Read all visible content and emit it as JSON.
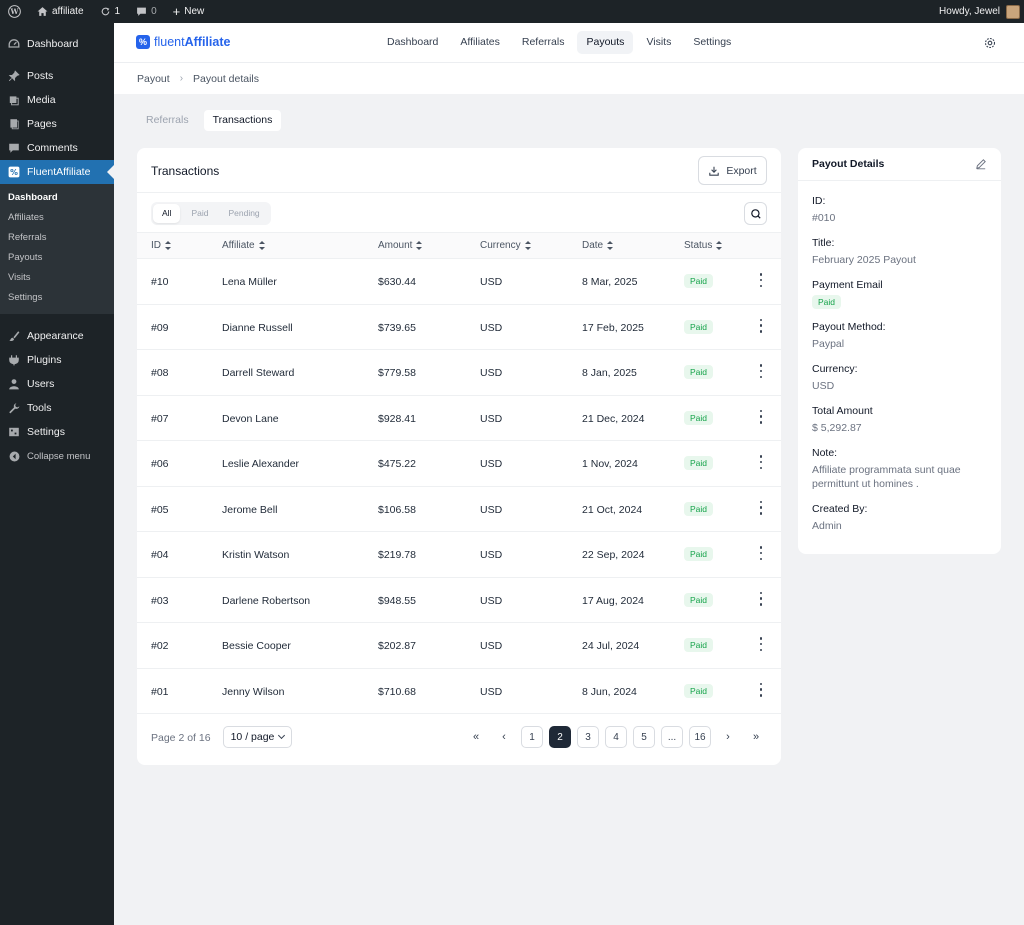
{
  "adminbar": {
    "site_name": "affiliate",
    "updates_count": "1",
    "comments_count": "0",
    "new_label": "New",
    "howdy": "Howdy, Jewel"
  },
  "sidebar": {
    "items_top": [
      {
        "label": "Dashboard",
        "icon": "dashboard-icon"
      }
    ],
    "items_content": [
      {
        "label": "Posts",
        "icon": "pin-icon"
      },
      {
        "label": "Media",
        "icon": "media-icon"
      },
      {
        "label": "Pages",
        "icon": "pages-icon"
      },
      {
        "label": "Comments",
        "icon": "comment-icon"
      }
    ],
    "active_item": {
      "label": "FluentAffiliate",
      "icon": "fluentaffiliate-icon"
    },
    "submenu": [
      "Dashboard",
      "Affiliates",
      "Referrals",
      "Payouts",
      "Visits",
      "Settings"
    ],
    "items_bottom": [
      {
        "label": "Appearance",
        "icon": "brush-icon"
      },
      {
        "label": "Plugins",
        "icon": "plugin-icon"
      },
      {
        "label": "Users",
        "icon": "user-icon"
      },
      {
        "label": "Tools",
        "icon": "wrench-icon"
      },
      {
        "label": "Settings",
        "icon": "settings-icon"
      }
    ],
    "collapse_label": "Collapse menu"
  },
  "header": {
    "logo_light": "fluent",
    "logo_bold": "Affiliate",
    "nav": [
      "Dashboard",
      "Affiliates",
      "Referrals",
      "Payouts",
      "Visits",
      "Settings"
    ],
    "active_nav": "Payouts"
  },
  "breadcrumb": {
    "root": "Payout",
    "current": "Payout details"
  },
  "page_tabs": [
    "Referrals",
    "Transactions"
  ],
  "transactions": {
    "title": "Transactions",
    "export_label": "Export",
    "filters": [
      "All",
      "Paid",
      "Pending"
    ],
    "columns": [
      "ID",
      "Affiliate",
      "Amount",
      "Currency",
      "Date",
      "Status"
    ],
    "rows": [
      {
        "id": "#10",
        "affiliate": "Lena Müller",
        "amount": "$630.44",
        "currency": "USD",
        "date": "8 Mar, 2025",
        "status": "Paid"
      },
      {
        "id": "#09",
        "affiliate": "Dianne Russell",
        "amount": "$739.65",
        "currency": "USD",
        "date": "17 Feb, 2025",
        "status": "Paid"
      },
      {
        "id": "#08",
        "affiliate": "Darrell Steward",
        "amount": "$779.58",
        "currency": "USD",
        "date": "8 Jan, 2025",
        "status": "Paid"
      },
      {
        "id": "#07",
        "affiliate": "Devon Lane",
        "amount": "$928.41",
        "currency": "USD",
        "date": "21 Dec, 2024",
        "status": "Paid"
      },
      {
        "id": "#06",
        "affiliate": "Leslie Alexander",
        "amount": "$475.22",
        "currency": "USD",
        "date": "1 Nov, 2024",
        "status": "Paid"
      },
      {
        "id": "#05",
        "affiliate": "Jerome Bell",
        "amount": "$106.58",
        "currency": "USD",
        "date": "21 Oct, 2024",
        "status": "Paid"
      },
      {
        "id": "#04",
        "affiliate": "Kristin Watson",
        "amount": "$219.78",
        "currency": "USD",
        "date": "22 Sep, 2024",
        "status": "Paid"
      },
      {
        "id": "#03",
        "affiliate": "Darlene Robertson",
        "amount": "$948.55",
        "currency": "USD",
        "date": "17 Aug, 2024",
        "status": "Paid"
      },
      {
        "id": "#02",
        "affiliate": "Bessie Cooper",
        "amount": "$202.87",
        "currency": "USD",
        "date": "24 Jul, 2024",
        "status": "Paid"
      },
      {
        "id": "#01",
        "affiliate": "Jenny Wilson",
        "amount": "$710.68",
        "currency": "USD",
        "date": "8 Jun, 2024",
        "status": "Paid"
      }
    ],
    "pagination": {
      "info": "Page 2 of 16",
      "per_page": "10 / page",
      "first": "«",
      "prev": "‹",
      "next": "›",
      "last": "»",
      "pages": [
        "1",
        "2",
        "3",
        "4",
        "5",
        "...",
        "16"
      ],
      "current": "2"
    }
  },
  "payout_details": {
    "title": "Payout Details",
    "fields": [
      {
        "label": "ID:",
        "value": "#010"
      },
      {
        "label": "Title:",
        "value": "February 2025 Payout"
      },
      {
        "label": "Payment Email",
        "badge": "Paid"
      },
      {
        "label": "Payout Method:",
        "value": "Paypal"
      },
      {
        "label": "Currency:",
        "value": "USD"
      },
      {
        "label": "Total Amount",
        "value": "$ 5,292.87"
      },
      {
        "label": "Note:",
        "value": "Affiliate programmata sunt quae permittunt ut homines ."
      },
      {
        "label": "Created By:",
        "value": "Admin"
      }
    ]
  },
  "colors": {
    "wp_dark": "#1d2327",
    "wp_blue": "#2271b1",
    "brand": "#2563eb",
    "paid_green": "#16a34a"
  }
}
